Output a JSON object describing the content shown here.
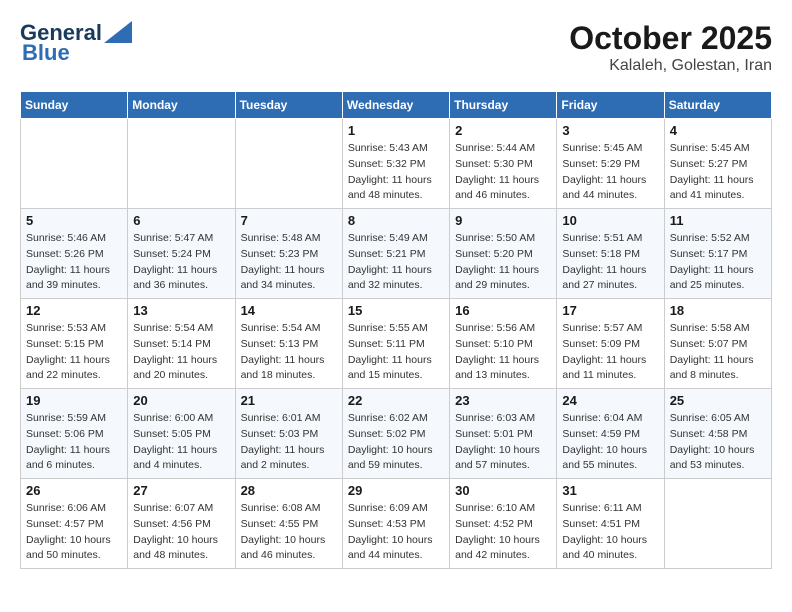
{
  "header": {
    "logo_line1": "General",
    "logo_line2": "Blue",
    "month": "October 2025",
    "location": "Kalaleh, Golestan, Iran"
  },
  "weekdays": [
    "Sunday",
    "Monday",
    "Tuesday",
    "Wednesday",
    "Thursday",
    "Friday",
    "Saturday"
  ],
  "weeks": [
    [
      {
        "day": "",
        "info": ""
      },
      {
        "day": "",
        "info": ""
      },
      {
        "day": "",
        "info": ""
      },
      {
        "day": "1",
        "info": "Sunrise: 5:43 AM\nSunset: 5:32 PM\nDaylight: 11 hours and 48 minutes."
      },
      {
        "day": "2",
        "info": "Sunrise: 5:44 AM\nSunset: 5:30 PM\nDaylight: 11 hours and 46 minutes."
      },
      {
        "day": "3",
        "info": "Sunrise: 5:45 AM\nSunset: 5:29 PM\nDaylight: 11 hours and 44 minutes."
      },
      {
        "day": "4",
        "info": "Sunrise: 5:45 AM\nSunset: 5:27 PM\nDaylight: 11 hours and 41 minutes."
      }
    ],
    [
      {
        "day": "5",
        "info": "Sunrise: 5:46 AM\nSunset: 5:26 PM\nDaylight: 11 hours and 39 minutes."
      },
      {
        "day": "6",
        "info": "Sunrise: 5:47 AM\nSunset: 5:24 PM\nDaylight: 11 hours and 36 minutes."
      },
      {
        "day": "7",
        "info": "Sunrise: 5:48 AM\nSunset: 5:23 PM\nDaylight: 11 hours and 34 minutes."
      },
      {
        "day": "8",
        "info": "Sunrise: 5:49 AM\nSunset: 5:21 PM\nDaylight: 11 hours and 32 minutes."
      },
      {
        "day": "9",
        "info": "Sunrise: 5:50 AM\nSunset: 5:20 PM\nDaylight: 11 hours and 29 minutes."
      },
      {
        "day": "10",
        "info": "Sunrise: 5:51 AM\nSunset: 5:18 PM\nDaylight: 11 hours and 27 minutes."
      },
      {
        "day": "11",
        "info": "Sunrise: 5:52 AM\nSunset: 5:17 PM\nDaylight: 11 hours and 25 minutes."
      }
    ],
    [
      {
        "day": "12",
        "info": "Sunrise: 5:53 AM\nSunset: 5:15 PM\nDaylight: 11 hours and 22 minutes."
      },
      {
        "day": "13",
        "info": "Sunrise: 5:54 AM\nSunset: 5:14 PM\nDaylight: 11 hours and 20 minutes."
      },
      {
        "day": "14",
        "info": "Sunrise: 5:54 AM\nSunset: 5:13 PM\nDaylight: 11 hours and 18 minutes."
      },
      {
        "day": "15",
        "info": "Sunrise: 5:55 AM\nSunset: 5:11 PM\nDaylight: 11 hours and 15 minutes."
      },
      {
        "day": "16",
        "info": "Sunrise: 5:56 AM\nSunset: 5:10 PM\nDaylight: 11 hours and 13 minutes."
      },
      {
        "day": "17",
        "info": "Sunrise: 5:57 AM\nSunset: 5:09 PM\nDaylight: 11 hours and 11 minutes."
      },
      {
        "day": "18",
        "info": "Sunrise: 5:58 AM\nSunset: 5:07 PM\nDaylight: 11 hours and 8 minutes."
      }
    ],
    [
      {
        "day": "19",
        "info": "Sunrise: 5:59 AM\nSunset: 5:06 PM\nDaylight: 11 hours and 6 minutes."
      },
      {
        "day": "20",
        "info": "Sunrise: 6:00 AM\nSunset: 5:05 PM\nDaylight: 11 hours and 4 minutes."
      },
      {
        "day": "21",
        "info": "Sunrise: 6:01 AM\nSunset: 5:03 PM\nDaylight: 11 hours and 2 minutes."
      },
      {
        "day": "22",
        "info": "Sunrise: 6:02 AM\nSunset: 5:02 PM\nDaylight: 10 hours and 59 minutes."
      },
      {
        "day": "23",
        "info": "Sunrise: 6:03 AM\nSunset: 5:01 PM\nDaylight: 10 hours and 57 minutes."
      },
      {
        "day": "24",
        "info": "Sunrise: 6:04 AM\nSunset: 4:59 PM\nDaylight: 10 hours and 55 minutes."
      },
      {
        "day": "25",
        "info": "Sunrise: 6:05 AM\nSunset: 4:58 PM\nDaylight: 10 hours and 53 minutes."
      }
    ],
    [
      {
        "day": "26",
        "info": "Sunrise: 6:06 AM\nSunset: 4:57 PM\nDaylight: 10 hours and 50 minutes."
      },
      {
        "day": "27",
        "info": "Sunrise: 6:07 AM\nSunset: 4:56 PM\nDaylight: 10 hours and 48 minutes."
      },
      {
        "day": "28",
        "info": "Sunrise: 6:08 AM\nSunset: 4:55 PM\nDaylight: 10 hours and 46 minutes."
      },
      {
        "day": "29",
        "info": "Sunrise: 6:09 AM\nSunset: 4:53 PM\nDaylight: 10 hours and 44 minutes."
      },
      {
        "day": "30",
        "info": "Sunrise: 6:10 AM\nSunset: 4:52 PM\nDaylight: 10 hours and 42 minutes."
      },
      {
        "day": "31",
        "info": "Sunrise: 6:11 AM\nSunset: 4:51 PM\nDaylight: 10 hours and 40 minutes."
      },
      {
        "day": "",
        "info": ""
      }
    ]
  ]
}
